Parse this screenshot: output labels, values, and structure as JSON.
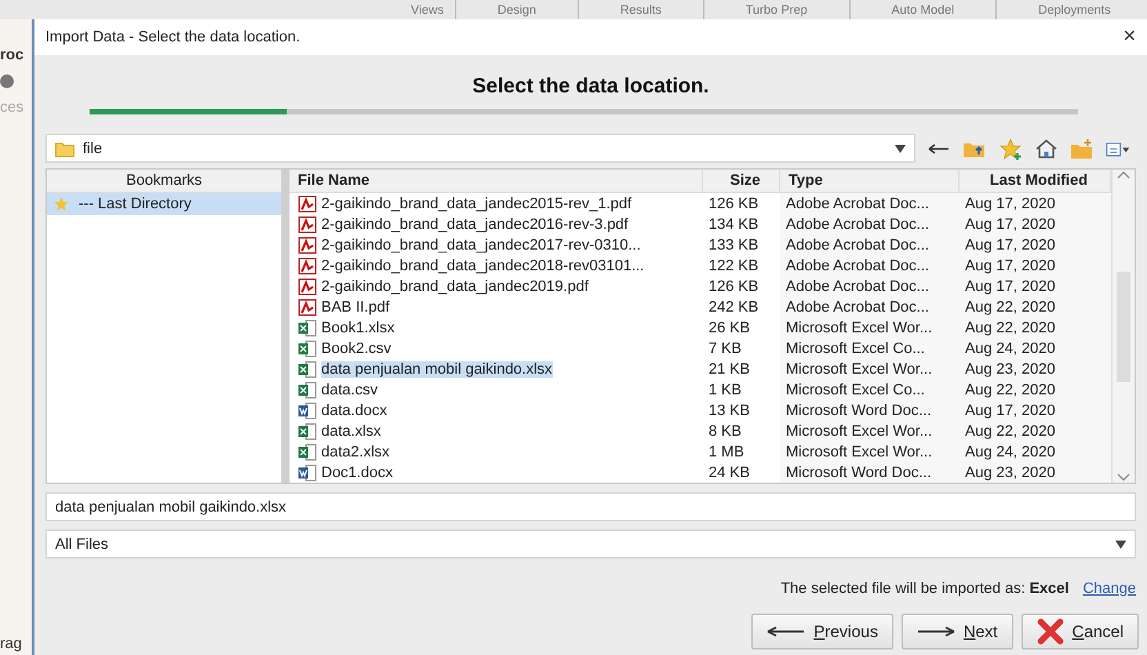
{
  "background_app": {
    "tabs": [
      "Views",
      "Design",
      "Results",
      "Turbo Prep",
      "Auto Model",
      "Deployments"
    ],
    "side_texts": [
      "roc",
      "ces",
      "rag"
    ]
  },
  "dialog": {
    "title": "Import Data - Select the data location.",
    "close": "×",
    "heading": "Select the data location.",
    "progress": {
      "level": 0.2
    },
    "path": {
      "value": "file"
    },
    "bookmarks": {
      "header": "Bookmarks",
      "items": [
        {
          "label": "--- Last Directory",
          "selected": true
        }
      ]
    },
    "files": {
      "columns": [
        "File Name",
        "Size",
        "Type",
        "Last Modified"
      ],
      "rows": [
        {
          "kind": "pdf",
          "name": "2-gaikindo_brand_data_jandec2015-rev_1.pdf",
          "size": "126 KB",
          "type": "Adobe Acrobat Doc...",
          "modified": "Aug 17, 2020",
          "selected": false
        },
        {
          "kind": "pdf",
          "name": "2-gaikindo_brand_data_jandec2016-rev-3.pdf",
          "size": "134 KB",
          "type": "Adobe Acrobat Doc...",
          "modified": "Aug 17, 2020",
          "selected": false
        },
        {
          "kind": "pdf",
          "name": "2-gaikindo_brand_data_jandec2017-rev-0310...",
          "size": "133 KB",
          "type": "Adobe Acrobat Doc...",
          "modified": "Aug 17, 2020",
          "selected": false
        },
        {
          "kind": "pdf",
          "name": "2-gaikindo_brand_data_jandec2018-rev03101...",
          "size": "122 KB",
          "type": "Adobe Acrobat Doc...",
          "modified": "Aug 17, 2020",
          "selected": false
        },
        {
          "kind": "pdf",
          "name": "2-gaikindo_brand_data_jandec2019.pdf",
          "size": "126 KB",
          "type": "Adobe Acrobat Doc...",
          "modified": "Aug 17, 2020",
          "selected": false
        },
        {
          "kind": "pdf",
          "name": "BAB II.pdf",
          "size": "242 KB",
          "type": "Adobe Acrobat Doc...",
          "modified": "Aug 22, 2020",
          "selected": false
        },
        {
          "kind": "excel",
          "name": "Book1.xlsx",
          "size": "26 KB",
          "type": "Microsoft Excel Wor...",
          "modified": "Aug 22, 2020",
          "selected": false
        },
        {
          "kind": "excel",
          "name": "Book2.csv",
          "size": "7 KB",
          "type": "Microsoft Excel Co...",
          "modified": "Aug 24, 2020",
          "selected": false
        },
        {
          "kind": "excel",
          "name": "data penjualan mobil gaikindo.xlsx",
          "size": "21 KB",
          "type": "Microsoft Excel Wor...",
          "modified": "Aug 23, 2020",
          "selected": true
        },
        {
          "kind": "excel",
          "name": "data.csv",
          "size": "1 KB",
          "type": "Microsoft Excel Co...",
          "modified": "Aug 22, 2020",
          "selected": false
        },
        {
          "kind": "word",
          "name": "data.docx",
          "size": "13 KB",
          "type": "Microsoft Word Doc...",
          "modified": "Aug 17, 2020",
          "selected": false
        },
        {
          "kind": "excel",
          "name": "data.xlsx",
          "size": "8 KB",
          "type": "Microsoft Excel Wor...",
          "modified": "Aug 22, 2020",
          "selected": false
        },
        {
          "kind": "excel",
          "name": "data2.xlsx",
          "size": "1 MB",
          "type": "Microsoft Excel Wor...",
          "modified": "Aug 24, 2020",
          "selected": false
        },
        {
          "kind": "word",
          "name": "Doc1.docx",
          "size": "24 KB",
          "type": "Microsoft Word Doc...",
          "modified": "Aug 23, 2020",
          "selected": false
        }
      ]
    },
    "file_name": {
      "value": "data penjualan mobil gaikindo.xlsx"
    },
    "filter": {
      "value": "All Files"
    },
    "import_info": {
      "text": "The selected file will be imported as: **Excel**",
      "link": "Change"
    },
    "buttons": [
      {
        "kind": "previous",
        "label": "Previous"
      },
      {
        "kind": "next",
        "label": "Next"
      },
      {
        "kind": "cancel",
        "label": "Cancel"
      }
    ]
  }
}
